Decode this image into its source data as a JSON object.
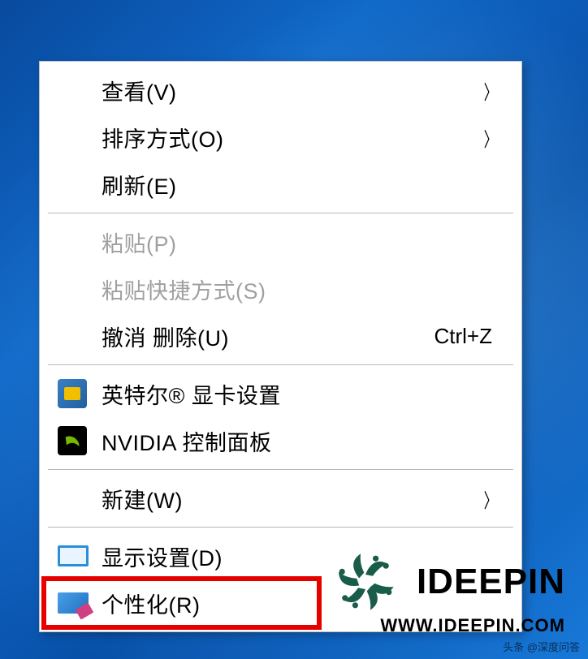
{
  "contextMenu": {
    "items": [
      {
        "label": "查看(V)",
        "hasSubmenu": true,
        "disabled": false,
        "icon": null,
        "shortcut": null
      },
      {
        "label": "排序方式(O)",
        "hasSubmenu": true,
        "disabled": false,
        "icon": null,
        "shortcut": null
      },
      {
        "label": "刷新(E)",
        "hasSubmenu": false,
        "disabled": false,
        "icon": null,
        "shortcut": null
      },
      {
        "separator": true
      },
      {
        "label": "粘贴(P)",
        "hasSubmenu": false,
        "disabled": true,
        "icon": null,
        "shortcut": null
      },
      {
        "label": "粘贴快捷方式(S)",
        "hasSubmenu": false,
        "disabled": true,
        "icon": null,
        "shortcut": null
      },
      {
        "label": "撤消 删除(U)",
        "hasSubmenu": false,
        "disabled": false,
        "icon": null,
        "shortcut": "Ctrl+Z"
      },
      {
        "separator": true
      },
      {
        "label": "英特尔® 显卡设置",
        "hasSubmenu": false,
        "disabled": false,
        "icon": "intel",
        "shortcut": null
      },
      {
        "label": "NVIDIA 控制面板",
        "hasSubmenu": false,
        "disabled": false,
        "icon": "nvidia",
        "shortcut": null
      },
      {
        "separator": true
      },
      {
        "label": "新建(W)",
        "hasSubmenu": true,
        "disabled": false,
        "icon": null,
        "shortcut": null
      },
      {
        "separator": true
      },
      {
        "label": "显示设置(D)",
        "hasSubmenu": false,
        "disabled": false,
        "icon": "display",
        "shortcut": null
      },
      {
        "label": "个性化(R)",
        "hasSubmenu": false,
        "disabled": false,
        "icon": "personalize",
        "shortcut": null,
        "highlighted": true
      }
    ]
  },
  "watermark": {
    "brand": "IDEEPIN",
    "url": "WWW.IDEEPIN.COM"
  },
  "attribution": "头条 @深度问答"
}
